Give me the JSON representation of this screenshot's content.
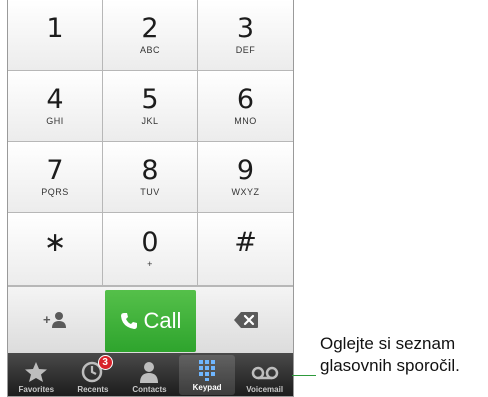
{
  "keypad": {
    "keys": [
      {
        "digit": "1",
        "letters": ""
      },
      {
        "digit": "2",
        "letters": "ABC"
      },
      {
        "digit": "3",
        "letters": "DEF"
      },
      {
        "digit": "4",
        "letters": "GHI"
      },
      {
        "digit": "5",
        "letters": "JKL"
      },
      {
        "digit": "6",
        "letters": "MNO"
      },
      {
        "digit": "7",
        "letters": "PQRS"
      },
      {
        "digit": "8",
        "letters": "TUV"
      },
      {
        "digit": "9",
        "letters": "WXYZ"
      },
      {
        "digit": "∗",
        "letters": ""
      },
      {
        "digit": "0",
        "letters": "+"
      },
      {
        "digit": "#",
        "letters": ""
      }
    ]
  },
  "actions": {
    "add_contact_icon": "add-contact-icon",
    "call_label": "Call",
    "call_color": "#3cb43a",
    "delete_icon": "backspace-icon"
  },
  "tabbar": {
    "tabs": [
      {
        "label": "Favorites",
        "icon": "star-icon"
      },
      {
        "label": "Recents",
        "icon": "clock-icon",
        "badge": "3"
      },
      {
        "label": "Contacts",
        "icon": "person-icon"
      },
      {
        "label": "Keypad",
        "icon": "keypad-grid-icon",
        "active": true
      },
      {
        "label": "Voicemail",
        "icon": "voicemail-icon"
      }
    ]
  },
  "callout": {
    "text": "Oglejte si seznam glasovnih sporočil.",
    "line_color": "#2e9a3c"
  }
}
